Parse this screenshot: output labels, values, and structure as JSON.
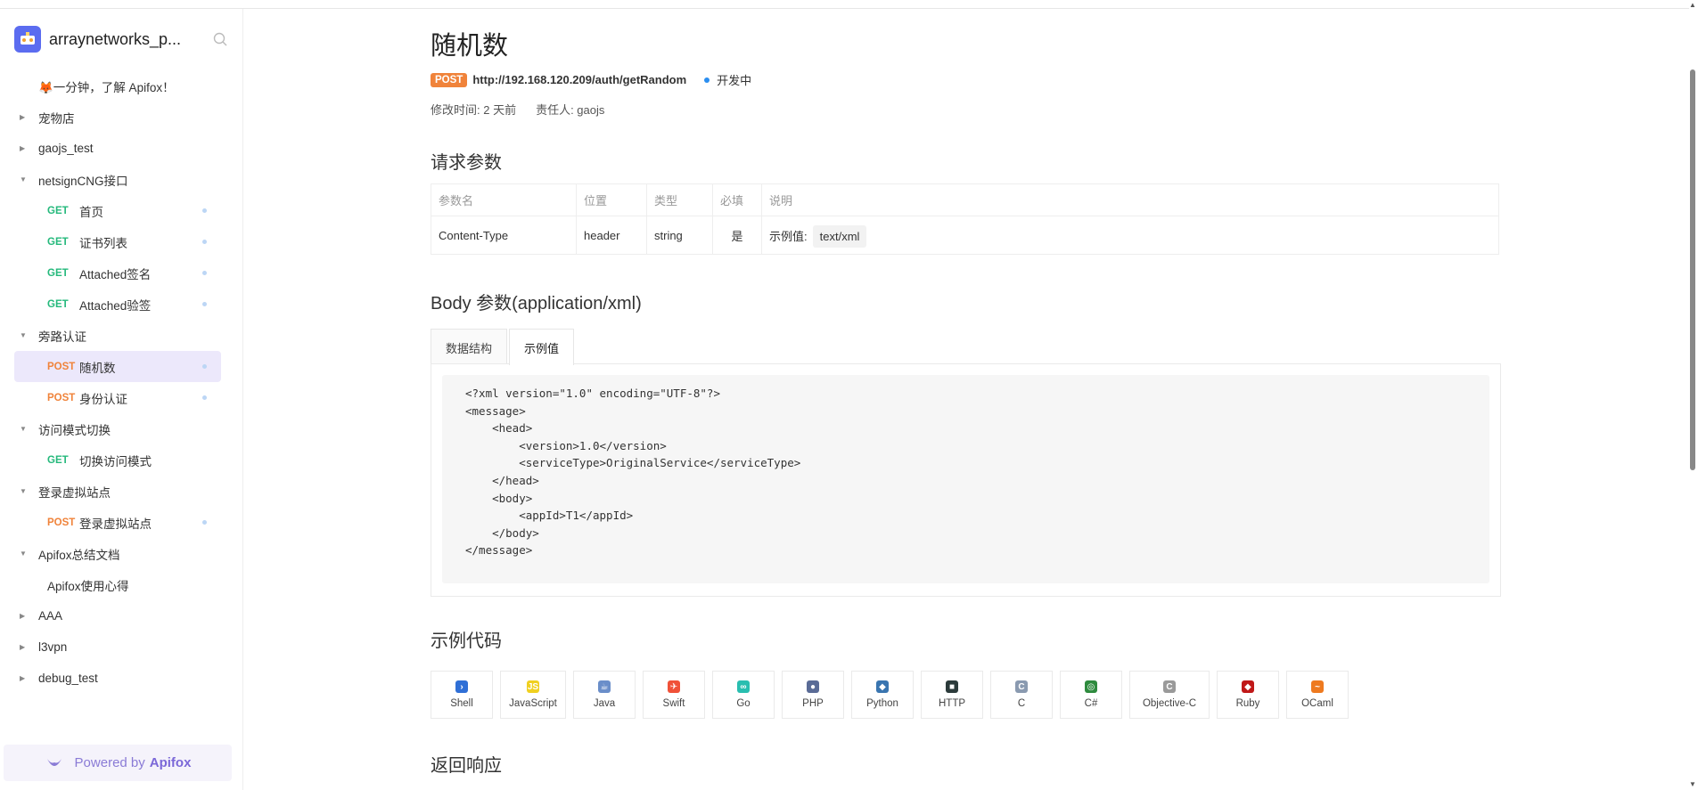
{
  "sidebar": {
    "project_title": "arraynetworks_p...",
    "intro_label": "🦊一分钟，了解 Apifox！",
    "tree": [
      {
        "type": "folder",
        "label": "宠物店",
        "expanded": false
      },
      {
        "type": "folder",
        "label": "gaojs_test",
        "expanded": false
      },
      {
        "type": "folder",
        "label": "netsignCNG接口",
        "expanded": true
      },
      {
        "type": "api",
        "method": "GET",
        "label": "首页"
      },
      {
        "type": "api",
        "method": "GET",
        "label": "证书列表"
      },
      {
        "type": "api",
        "method": "GET",
        "label": "Attached签名"
      },
      {
        "type": "api",
        "method": "GET",
        "label": "Attached验签"
      },
      {
        "type": "folder",
        "label": "旁路认证",
        "expanded": true
      },
      {
        "type": "api",
        "method": "POST",
        "label": "随机数",
        "active": true
      },
      {
        "type": "api",
        "method": "POST",
        "label": "身份认证"
      },
      {
        "type": "folder",
        "label": "访问模式切换",
        "expanded": true
      },
      {
        "type": "api",
        "method": "GET",
        "label": "切换访问模式",
        "nodot": true
      },
      {
        "type": "folder",
        "label": "登录虚拟站点",
        "expanded": true
      },
      {
        "type": "api",
        "method": "POST",
        "label": "登录虚拟站点"
      },
      {
        "type": "folder",
        "label": "Apifox总结文档",
        "expanded": true
      },
      {
        "type": "doc",
        "label": "Apifox使用心得"
      },
      {
        "type": "folder",
        "label": "AAA",
        "expanded": false
      },
      {
        "type": "folder",
        "label": "l3vpn",
        "expanded": false
      },
      {
        "type": "folder",
        "label": "debug_test",
        "expanded": false
      }
    ],
    "powered_prefix": "Powered by",
    "powered_brand": "Apifox"
  },
  "api": {
    "title": "随机数",
    "method": "POST",
    "url": "http://192.168.120.209/auth/getRandom",
    "status": "开发中",
    "modified": "修改时间: 2 天前",
    "owner": "责任人: gaojs"
  },
  "request_params": {
    "heading": "请求参数",
    "columns": [
      "参数名",
      "位置",
      "类型",
      "必填",
      "说明"
    ],
    "row": {
      "name": "Content-Type",
      "location": "header",
      "type": "string",
      "required": "是",
      "desc_label": "示例值:",
      "example": "text/xml"
    }
  },
  "body": {
    "heading": "Body 参数(application/xml)",
    "tabs": [
      "数据结构",
      "示例值"
    ],
    "active_tab": "示例值",
    "code_lines": [
      "<?xml version=\"1.0\" encoding=\"UTF-8\"?>",
      "<message>",
      "    <head>",
      "        <version>1.0</version>",
      "        <serviceType>OriginalService</serviceType>",
      "    </head>",
      "    <body>",
      "        <appId>T1</appId>",
      "    </body>",
      "</message>"
    ]
  },
  "sample_code": {
    "heading": "示例代码",
    "languages": [
      {
        "label": "Shell",
        "icon": "shell-icon",
        "color": "#2f6fd6"
      },
      {
        "label": "JavaScript",
        "icon": "javascript-icon",
        "color": "#f0d020"
      },
      {
        "label": "Java",
        "icon": "java-icon",
        "color": "#6a8ec9"
      },
      {
        "label": "Swift",
        "icon": "swift-icon",
        "color": "#f05138"
      },
      {
        "label": "Go",
        "icon": "go-icon",
        "color": "#29beb0"
      },
      {
        "label": "PHP",
        "icon": "php-icon",
        "color": "#5a6b96"
      },
      {
        "label": "Python",
        "icon": "python-icon",
        "color": "#3a75b0"
      },
      {
        "label": "HTTP",
        "icon": "http-icon",
        "color": "#2b3a3a"
      },
      {
        "label": "C",
        "icon": "c-icon",
        "color": "#8a9ab0"
      },
      {
        "label": "C#",
        "icon": "csharp-icon",
        "color": "#2e8b3e"
      },
      {
        "label": "Objective-C",
        "icon": "objective-c-icon",
        "color": "#9a9a9a"
      },
      {
        "label": "Ruby",
        "icon": "ruby-icon",
        "color": "#c01818"
      },
      {
        "label": "OCaml",
        "icon": "ocaml-icon",
        "color": "#ee7a20"
      }
    ]
  },
  "response": {
    "heading": "返回响应"
  }
}
